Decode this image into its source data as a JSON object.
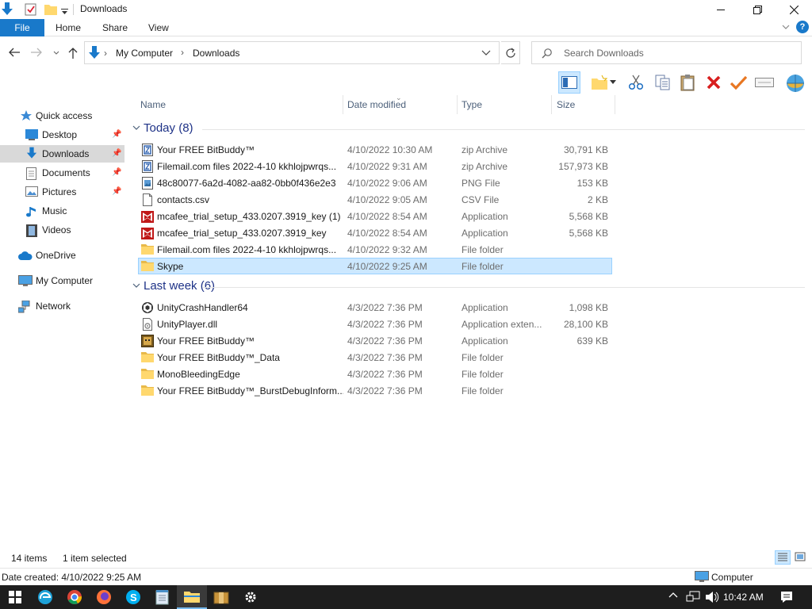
{
  "window": {
    "title": "Downloads"
  },
  "ribbon": {
    "tabs": [
      {
        "label": "File"
      },
      {
        "label": "Home"
      },
      {
        "label": "Share"
      },
      {
        "label": "View"
      }
    ],
    "help_label": "?"
  },
  "address": {
    "parts": [
      "My Computer",
      "Downloads"
    ]
  },
  "search": {
    "placeholder": "Search Downloads"
  },
  "nav_pane": {
    "items": [
      {
        "label": "Quick access",
        "icon": "star-icon"
      },
      {
        "label": "Desktop",
        "icon": "desktop-icon",
        "pinned": true
      },
      {
        "label": "Downloads",
        "icon": "download-arrow-icon",
        "pinned": true,
        "selected": true
      },
      {
        "label": "Documents",
        "icon": "document-icon",
        "pinned": true
      },
      {
        "label": "Pictures",
        "icon": "pictures-icon",
        "pinned": true
      },
      {
        "label": "Music",
        "icon": "music-icon"
      },
      {
        "label": "Videos",
        "icon": "film-icon"
      },
      {
        "label": "OneDrive",
        "icon": "cloud-icon"
      },
      {
        "label": "My Computer",
        "icon": "computer-icon"
      },
      {
        "label": "Network",
        "icon": "network-icon"
      }
    ]
  },
  "columns": {
    "name": "Name",
    "date": "Date modified",
    "type": "Type",
    "size": "Size"
  },
  "groups": [
    {
      "label": "Today (8)",
      "files": [
        {
          "name": "Your FREE BitBuddy™",
          "date": "4/10/2022 10:30 AM",
          "type": "zip Archive",
          "size": "30,791 KB",
          "icon": "zip"
        },
        {
          "name": "Filemail.com files 2022-4-10 kkhlojpwrqs...",
          "date": "4/10/2022 9:31 AM",
          "type": "zip Archive",
          "size": "157,973 KB",
          "icon": "zip"
        },
        {
          "name": "48c80077-6a2d-4082-aa82-0bb0f436e2e3",
          "date": "4/10/2022 9:06 AM",
          "type": "PNG File",
          "size": "153 KB",
          "icon": "png"
        },
        {
          "name": "contacts.csv",
          "date": "4/10/2022 9:05 AM",
          "type": "CSV File",
          "size": "2 KB",
          "icon": "file"
        },
        {
          "name": "mcafee_trial_setup_433.0207.3919_key (1)",
          "date": "4/10/2022 8:54 AM",
          "type": "Application",
          "size": "5,568 KB",
          "icon": "mcafee"
        },
        {
          "name": "mcafee_trial_setup_433.0207.3919_key",
          "date": "4/10/2022 8:54 AM",
          "type": "Application",
          "size": "5,568 KB",
          "icon": "mcafee"
        },
        {
          "name": "Filemail.com files 2022-4-10 kkhlojpwrqs...",
          "date": "4/10/2022 9:32 AM",
          "type": "File folder",
          "size": "",
          "icon": "folder"
        },
        {
          "name": "Skype",
          "date": "4/10/2022 9:25 AM",
          "type": "File folder",
          "size": "",
          "icon": "folder",
          "selected": true
        }
      ]
    },
    {
      "label": "Last week (6)",
      "files": [
        {
          "name": "UnityCrashHandler64",
          "date": "4/3/2022 7:36 PM",
          "type": "Application",
          "size": "1,098 KB",
          "icon": "unity"
        },
        {
          "name": "UnityPlayer.dll",
          "date": "4/3/2022 7:36 PM",
          "type": "Application exten...",
          "size": "28,100 KB",
          "icon": "dll"
        },
        {
          "name": "Your FREE BitBuddy™",
          "date": "4/3/2022 7:36 PM",
          "type": "Application",
          "size": "639 KB",
          "icon": "app"
        },
        {
          "name": "Your FREE BitBuddy™_Data",
          "date": "4/3/2022 7:36 PM",
          "type": "File folder",
          "size": "",
          "icon": "folder"
        },
        {
          "name": "MonoBleedingEdge",
          "date": "4/3/2022 7:36 PM",
          "type": "File folder",
          "size": "",
          "icon": "folder"
        },
        {
          "name": "Your FREE BitBuddy™_BurstDebugInform...",
          "date": "4/3/2022 7:36 PM",
          "type": "File folder",
          "size": "",
          "icon": "folder"
        }
      ]
    }
  ],
  "status": {
    "count": "14 items",
    "selection": "1 item selected"
  },
  "details": {
    "created": "Date created: 4/10/2022 9:25 AM",
    "location": "Computer"
  },
  "taskbar": {
    "apps": [
      "windows-start-icon",
      "edge-icon",
      "chrome-icon",
      "firefox-icon",
      "skype-icon",
      "notepad-icon",
      "file-explorer-icon",
      "archive-icon",
      "settings-gear-icon"
    ],
    "time": "10:42 AM"
  },
  "colors": {
    "accent": "#1979ca",
    "selection_bg": "#cce8ff",
    "group_header": "#1e3287",
    "folder": "#ffd86e"
  }
}
